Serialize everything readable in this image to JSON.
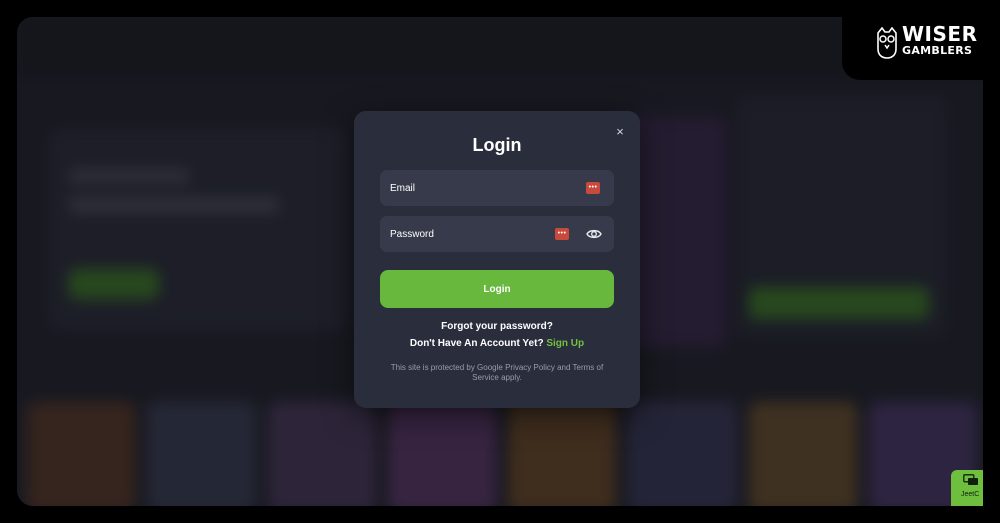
{
  "modal": {
    "title": "Login",
    "close_symbol": "×",
    "email_placeholder": "Email",
    "password_placeholder": "Password",
    "login_button": "Login",
    "forgot_password": "Forgot your password?",
    "no_account_text": "Don't Have An Account Yet?",
    "signup_link": "Sign Up",
    "recaptcha_notice": "This site is protected by Google Privacy Policy and Terms of Service apply.",
    "password_manager_glyph": "•••",
    "icons": [
      "close-icon",
      "password-manager-icon",
      "eye-icon"
    ]
  },
  "logo": {
    "line1": "WISER",
    "line2": "GAMBLERS",
    "icon": "owl-logo-icon"
  },
  "chat_widget": {
    "label": "JeetC",
    "icon": "chat-icon"
  },
  "colors": {
    "accent_green": "#67b83c",
    "link_green": "#74c043",
    "modal_bg": "#2a2d3b",
    "field_bg": "#363a4a"
  }
}
